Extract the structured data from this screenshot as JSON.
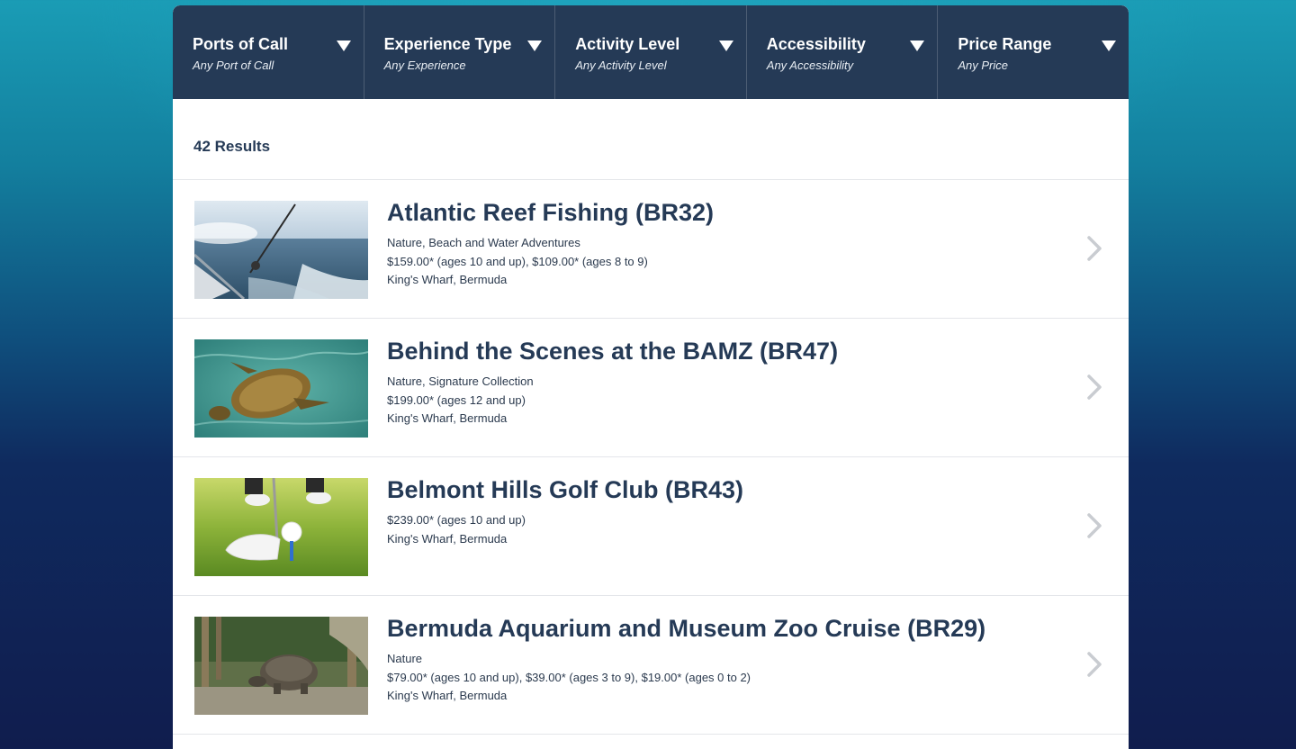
{
  "filters": [
    {
      "title": "Ports of Call",
      "value": "Any Port of Call"
    },
    {
      "title": "Experience Type",
      "value": "Any Experience"
    },
    {
      "title": "Activity Level",
      "value": "Any Activity Level"
    },
    {
      "title": "Accessibility",
      "value": "Any Accessibility"
    },
    {
      "title": "Price Range",
      "value": "Any Price"
    }
  ],
  "results": {
    "count_label": "42 Results",
    "items": [
      {
        "title": "Atlantic Reef Fishing (BR32)",
        "category": "Nature, Beach and Water Adventures",
        "price": "$159.00* (ages 10 and up), $109.00* (ages 8 to 9)",
        "location": "King's Wharf, Bermuda",
        "image": "fishing-photo"
      },
      {
        "title": "Behind the Scenes at the BAMZ (BR47)",
        "category": "Nature, Signature Collection",
        "price": "$199.00* (ages 12 and up)",
        "location": "King's Wharf, Bermuda",
        "image": "sea-turtle-photo"
      },
      {
        "title": "Belmont Hills Golf Club (BR43)",
        "category": "",
        "price": "$239.00* (ages 10 and up)",
        "location": "King's Wharf, Bermuda",
        "image": "golf-tee-photo"
      },
      {
        "title": "Bermuda Aquarium and Museum Zoo Cruise (BR29)",
        "category": "Nature",
        "price": "$79.00* (ages 10 and up), $39.00* (ages 3 to 9), $19.00* (ages 0 to 2)",
        "location": "King's Wharf, Bermuda",
        "image": "tortoise-photo"
      }
    ]
  },
  "colors": {
    "header_bg": "#253a56",
    "title_text": "#253a56",
    "chevron": "#c9ccd1"
  }
}
